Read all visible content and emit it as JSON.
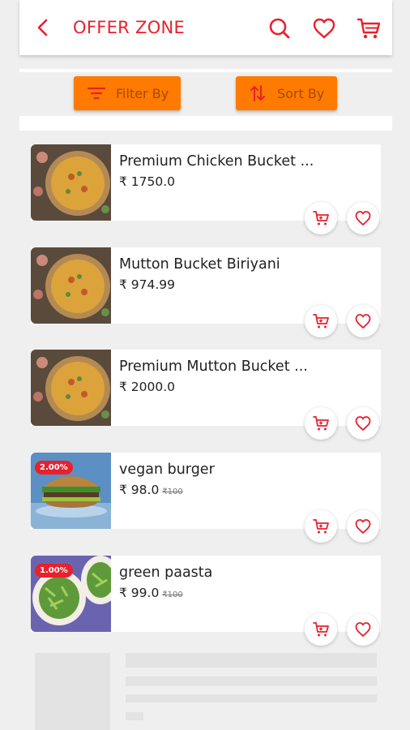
{
  "header": {
    "title": "OFFER ZONE",
    "accent": "#e8212d"
  },
  "toolbar": {
    "filter_label": "Filter By",
    "sort_label": "Sort By",
    "button_color": "#ff7a00"
  },
  "products": [
    {
      "name": "Premium Chicken Bucket ...",
      "price": "₹ 1750.0",
      "old_price": "",
      "badge": "",
      "image": "biryani"
    },
    {
      "name": "Mutton Bucket Biriyani",
      "price": "₹ 974.99",
      "old_price": "",
      "badge": "",
      "image": "biryani"
    },
    {
      "name": "Premium Mutton Bucket ...",
      "price": "₹ 2000.0",
      "old_price": "",
      "badge": "",
      "image": "biryani"
    },
    {
      "name": "vegan burger",
      "price": "₹ 98.0",
      "old_price": "₹100",
      "badge": "2.00%",
      "image": "burger"
    },
    {
      "name": "green paasta",
      "price": "₹ 99.0",
      "old_price": "₹100",
      "badge": "1.00%",
      "image": "pasta"
    }
  ]
}
